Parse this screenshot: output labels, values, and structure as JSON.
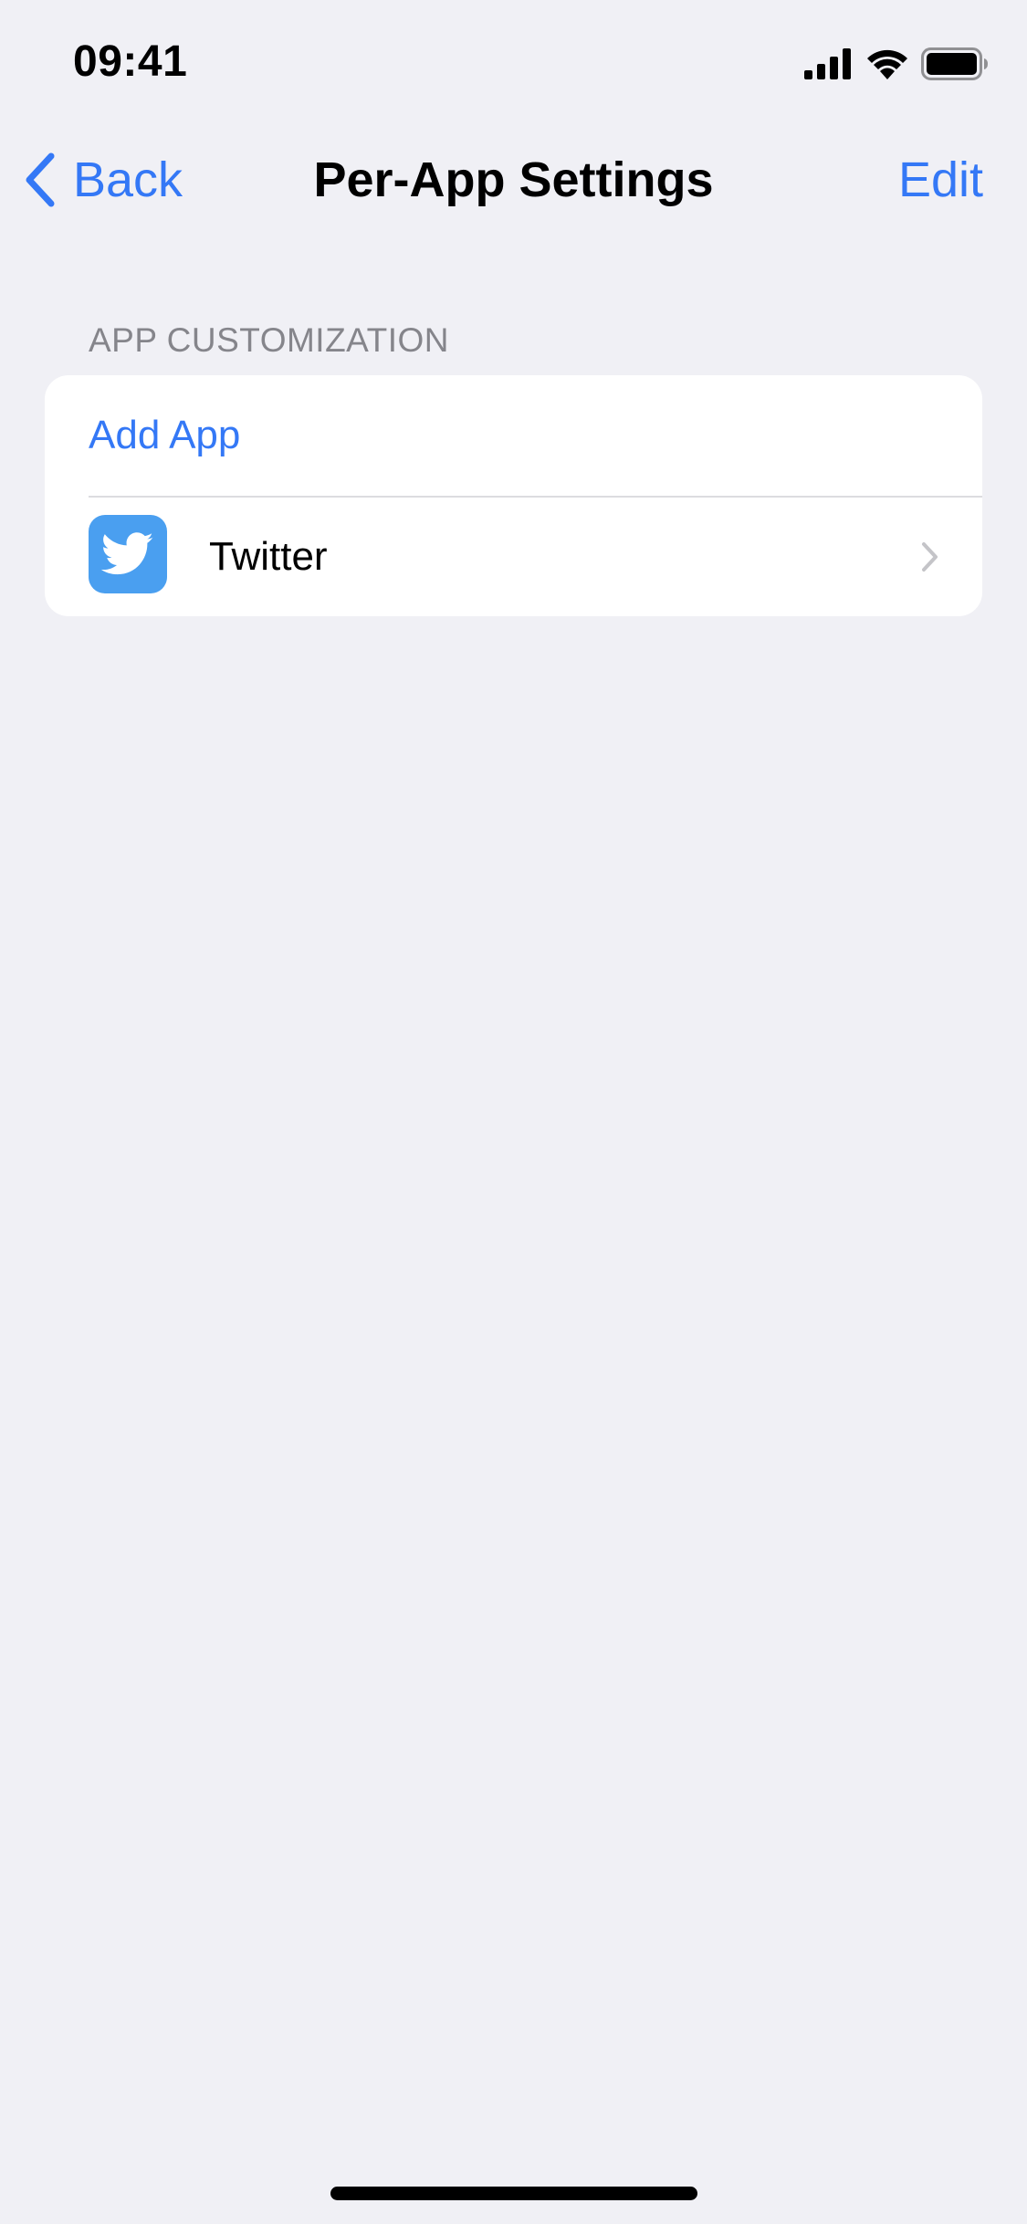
{
  "status_bar": {
    "time": "09:41",
    "icons": [
      "cellular-signal-icon",
      "wifi-icon",
      "battery-icon"
    ]
  },
  "nav": {
    "back_label": "Back",
    "title": "Per-App Settings",
    "edit_label": "Edit"
  },
  "section": {
    "header": "APP CUSTOMIZATION",
    "add_label": "Add App",
    "apps": [
      {
        "name": "Twitter",
        "icon": "twitter-bird-icon"
      }
    ]
  },
  "colors": {
    "accent": "#3478f6",
    "background": "#f0f0f5",
    "secondary_text": "#85858b",
    "twitter_blue": "#4a9ff0"
  }
}
